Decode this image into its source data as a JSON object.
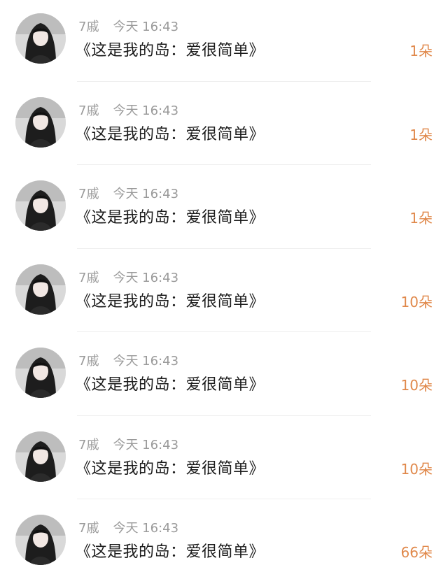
{
  "gift_list": {
    "items": [
      {
        "nickname": "7戚",
        "time": "今天 16:43",
        "message": "《这是我的岛：爱很简单》",
        "count": "1朵",
        "avatar_icon": "user-avatar"
      },
      {
        "nickname": "7戚",
        "time": "今天 16:43",
        "message": "《这是我的岛：爱很简单》",
        "count": "1朵",
        "avatar_icon": "user-avatar"
      },
      {
        "nickname": "7戚",
        "time": "今天 16:43",
        "message": "《这是我的岛：爱很简单》",
        "count": "1朵",
        "avatar_icon": "user-avatar"
      },
      {
        "nickname": "7戚",
        "time": "今天 16:43",
        "message": "《这是我的岛：爱很简单》",
        "count": "10朵",
        "avatar_icon": "user-avatar"
      },
      {
        "nickname": "7戚",
        "time": "今天 16:43",
        "message": "《这是我的岛：爱很简单》",
        "count": "10朵",
        "avatar_icon": "user-avatar"
      },
      {
        "nickname": "7戚",
        "time": "今天 16:43",
        "message": "《这是我的岛：爱很简单》",
        "count": "10朵",
        "avatar_icon": "user-avatar"
      },
      {
        "nickname": "7戚",
        "time": "今天 16:43",
        "message": "《这是我的岛：爱很简单》",
        "count": "66朵",
        "avatar_icon": "user-avatar"
      }
    ]
  },
  "colors": {
    "count_text": "#e0884a",
    "meta_text": "#9a9a9a",
    "message_text": "#1b1b1b",
    "divider": "#eeeeee"
  }
}
